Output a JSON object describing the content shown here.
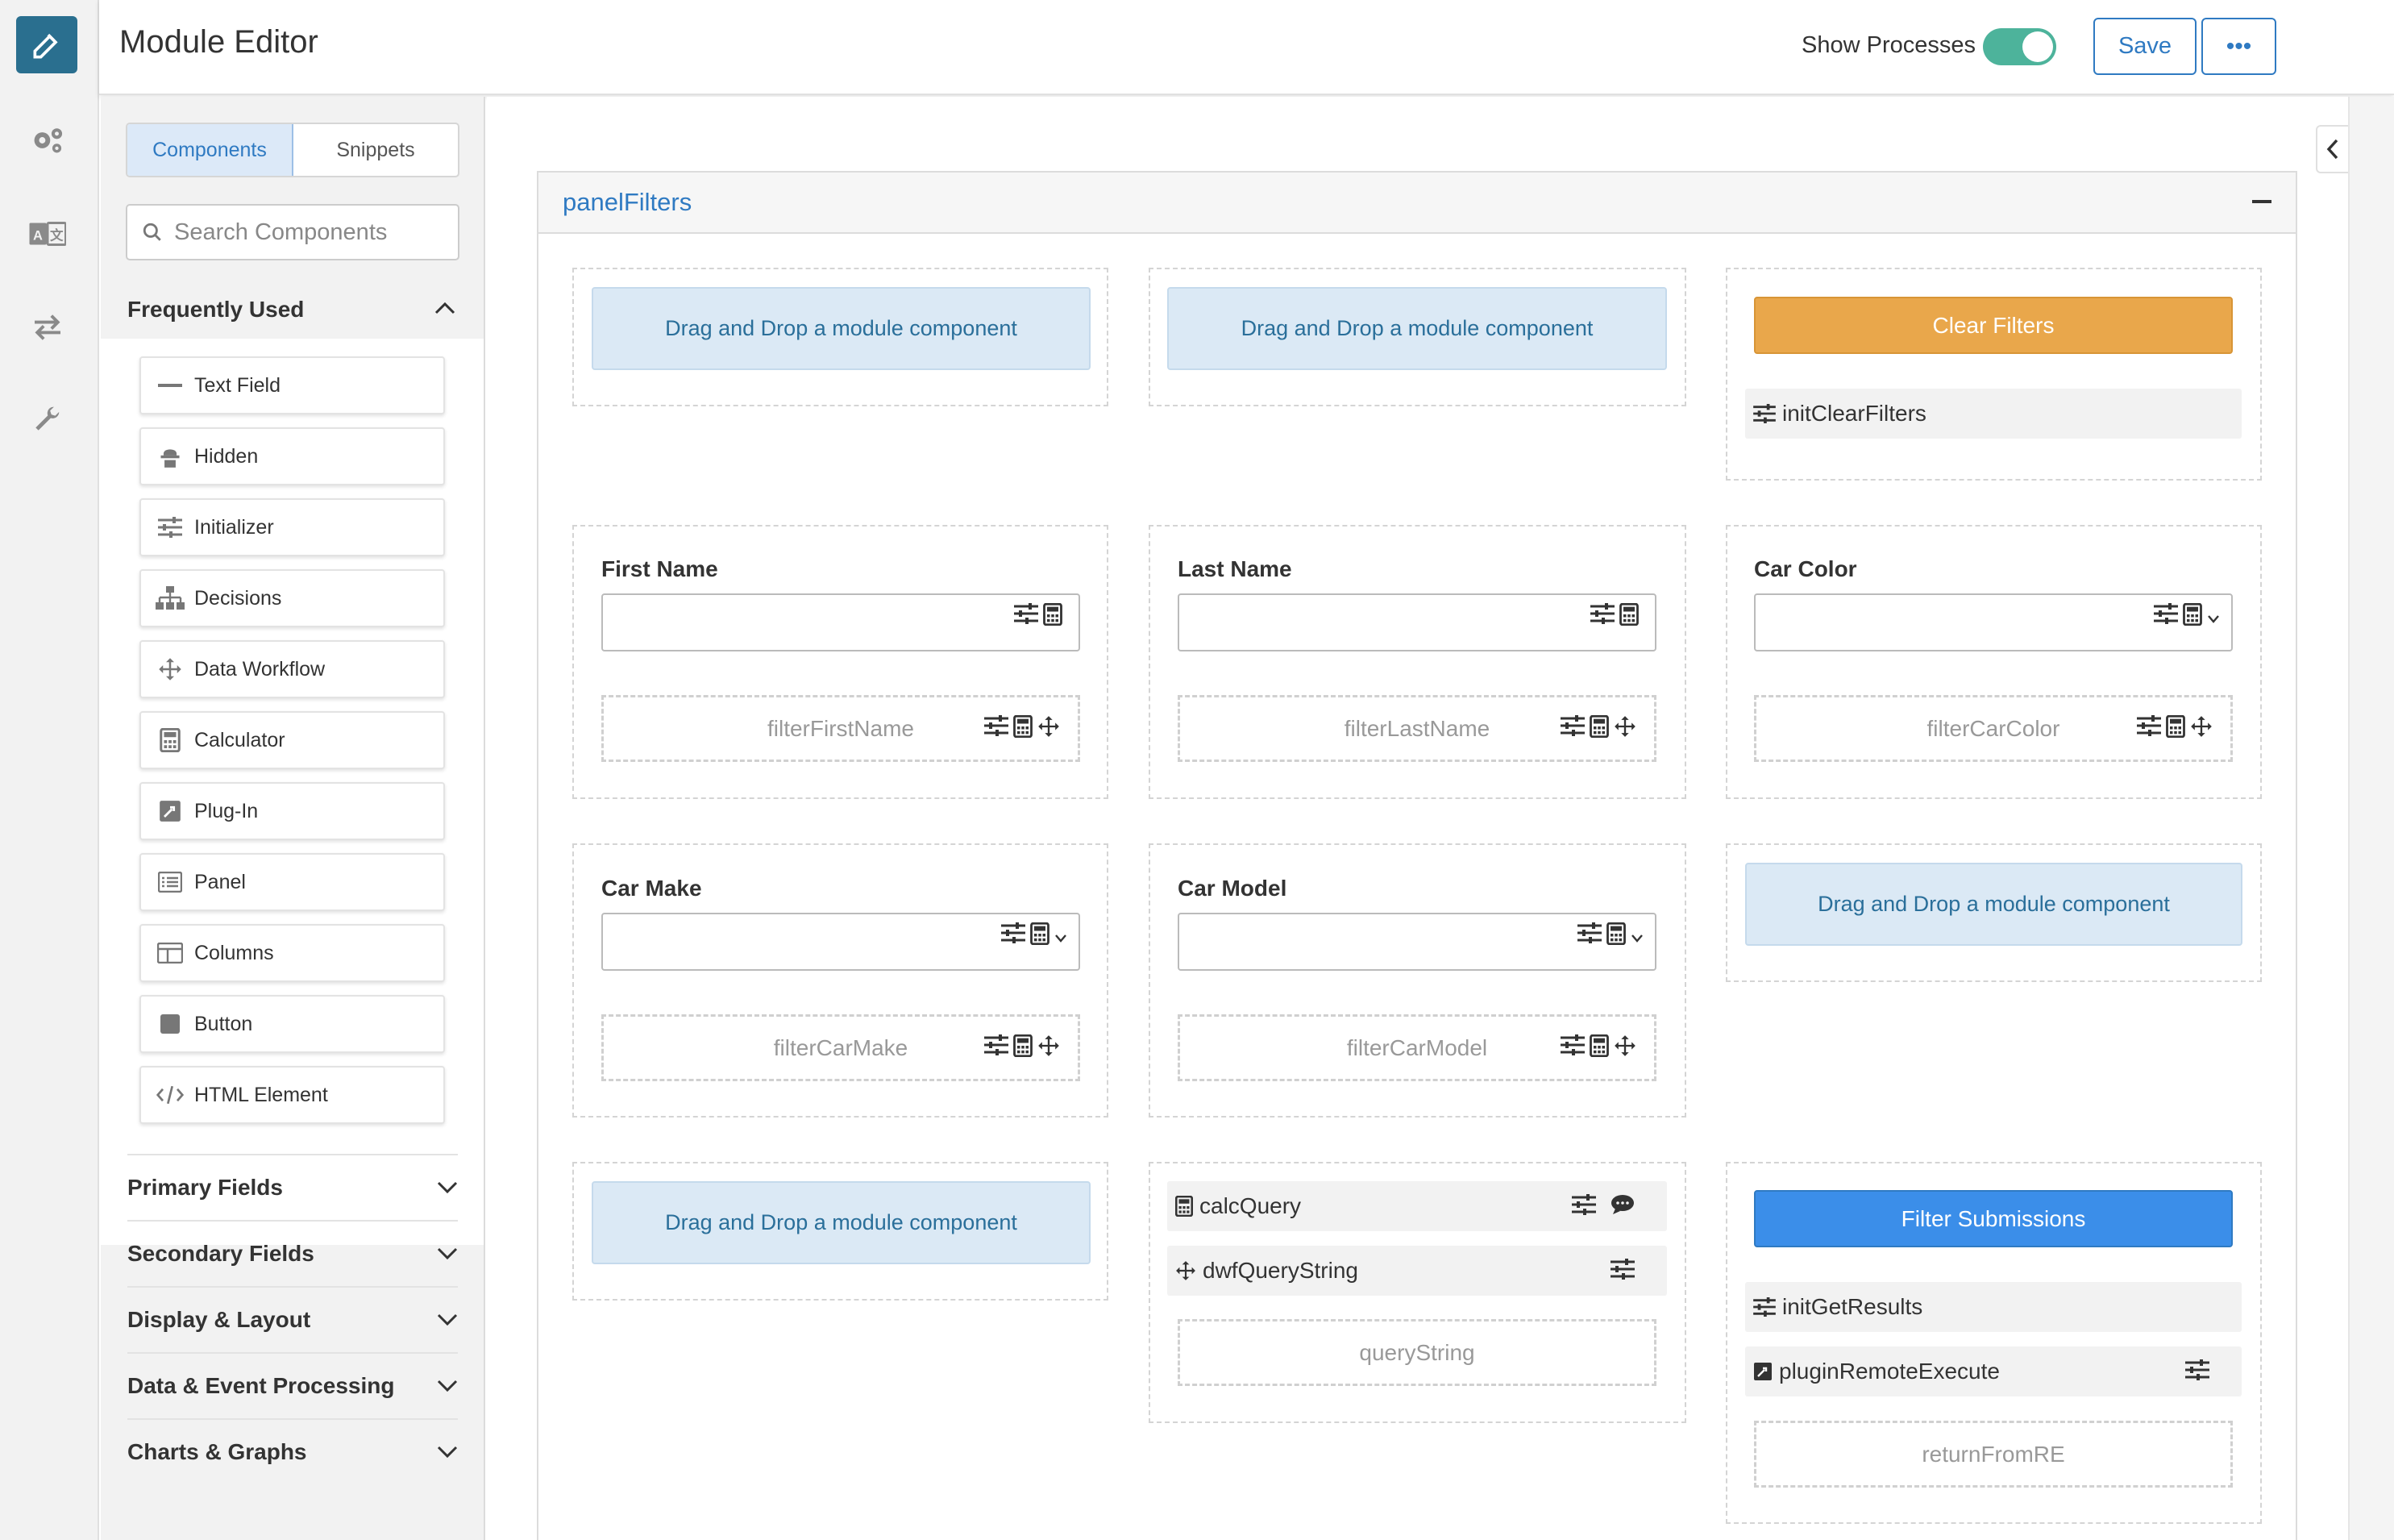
{
  "header": {
    "title": "Module Editor",
    "show_processes_label": "Show Processes",
    "show_processes_on": true,
    "save_label": "Save",
    "more_label": "•••"
  },
  "rail": {
    "items": [
      "edit-icon",
      "gear-icon",
      "translate-icon",
      "swap-icon",
      "wrench-icon"
    ]
  },
  "panel": {
    "tabs": [
      {
        "label": "Components",
        "active": true
      },
      {
        "label": "Snippets",
        "active": false
      }
    ],
    "search_placeholder": "Search Components",
    "frequently_used_label": "Frequently Used",
    "frequently_used": [
      {
        "label": "Text Field",
        "icon": "text-field-icon"
      },
      {
        "label": "Hidden",
        "icon": "hidden-icon"
      },
      {
        "label": "Initializer",
        "icon": "initializer-icon"
      },
      {
        "label": "Decisions",
        "icon": "decisions-icon"
      },
      {
        "label": "Data Workflow",
        "icon": "data-workflow-icon"
      },
      {
        "label": "Calculator",
        "icon": "calculator-icon"
      },
      {
        "label": "Plug-In",
        "icon": "plugin-icon"
      },
      {
        "label": "Panel",
        "icon": "panel-icon"
      },
      {
        "label": "Columns",
        "icon": "columns-icon"
      },
      {
        "label": "Button",
        "icon": "button-icon"
      },
      {
        "label": "HTML Element",
        "icon": "html-element-icon"
      }
    ],
    "categories": [
      "Primary Fields",
      "Secondary Fields",
      "Display & Layout",
      "Data & Event Processing",
      "Charts & Graphs"
    ]
  },
  "canvas": {
    "panel_title": "panelFilters",
    "dnd_text": "Drag and Drop a module component",
    "clear_filters_label": "Clear Filters",
    "init_clear_filters": "initClearFilters",
    "fields": [
      {
        "label": "First Name",
        "hidden": "filterFirstName"
      },
      {
        "label": "Last Name",
        "hidden": "filterLastName"
      },
      {
        "label": "Car Color",
        "hidden": "filterCarColor"
      },
      {
        "label": "Car Make",
        "hidden": "filterCarMake"
      },
      {
        "label": "Car Model",
        "hidden": "filterCarModel"
      }
    ],
    "calc_query": "calcQuery",
    "dwf_query_string": "dwfQueryString",
    "query_string": "queryString",
    "filter_submissions_label": "Filter Submissions",
    "init_get_results": "initGetResults",
    "plugin_remote_execute": "pluginRemoteExecute",
    "return_from_re": "returnFromRE"
  },
  "colors": {
    "accent": "#2f7ac2",
    "rail_logo": "#2a6f8f",
    "toggle_on": "#4db39b",
    "clear_filters": "#e9a74b",
    "filter_submissions": "#3b8ee9",
    "dnd_bg": "#dbe9f5"
  }
}
